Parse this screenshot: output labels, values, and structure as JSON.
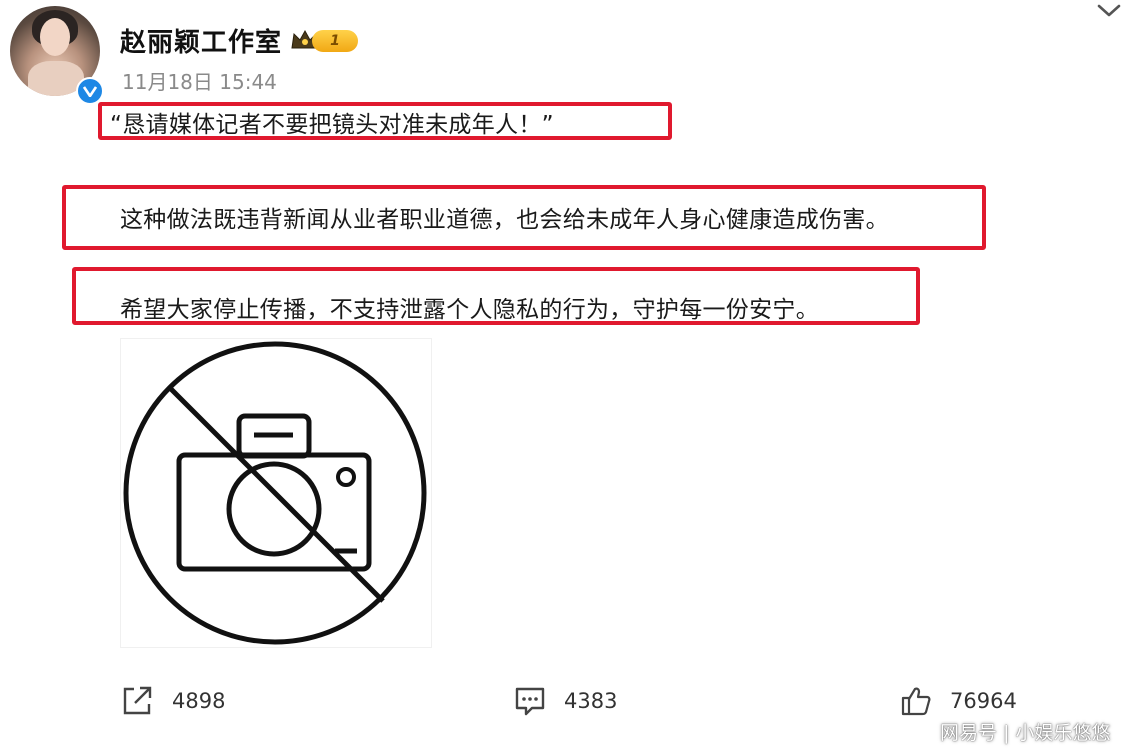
{
  "post": {
    "author_name": "赵丽颖工作室",
    "level_badge": "1",
    "timestamp": "11月18日 15:44",
    "lines": [
      "“恳请媒体记者不要把镜头对准未成年人！”",
      "这种做法既违背新闻从业者职业道德，也会给未成年人身心健康造成伤害。",
      "希望大家停止传播，不支持泄露个人隐私的行为，守护每一份安宁。"
    ],
    "highlight_color": "#e0192e"
  },
  "icons": {
    "avatar": "avatar-icon",
    "verified": "verified-icon",
    "badge": "crown-icon",
    "chevron": "chevron-down-icon",
    "image": "no-camera-icon",
    "repost": "repost-icon",
    "comment": "comment-icon",
    "like": "like-icon"
  },
  "actions": {
    "repost_count": "4898",
    "comment_count": "4383",
    "like_count": "76964"
  },
  "watermark": "网易号 | 小娱乐悠悠"
}
